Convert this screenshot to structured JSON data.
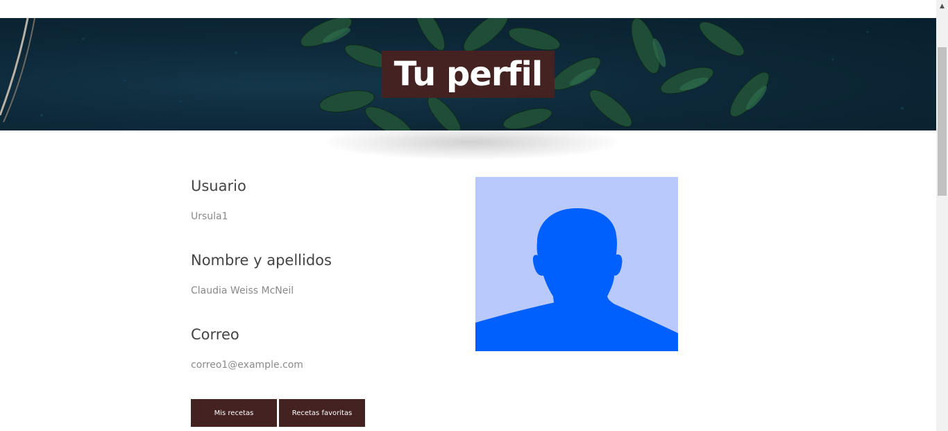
{
  "hero": {
    "title": "Tu perfil"
  },
  "profile": {
    "fields": [
      {
        "label": "Usuario",
        "value": "Ursula1"
      },
      {
        "label": "Nombre y apellidos",
        "value": "Claudia Weiss McNeil"
      },
      {
        "label": "Correo",
        "value": "correo1@example.com"
      }
    ],
    "avatar_icon": "user-silhouette-icon"
  },
  "actions": {
    "my_recipes_label": "Mis recetas",
    "favorite_recipes_label": "Recetas favoritas"
  },
  "colors": {
    "accent": "#432221",
    "hero_bg": "#0d2838",
    "avatar_bg": "#b9c9fb",
    "avatar_fg": "#0060fe"
  }
}
